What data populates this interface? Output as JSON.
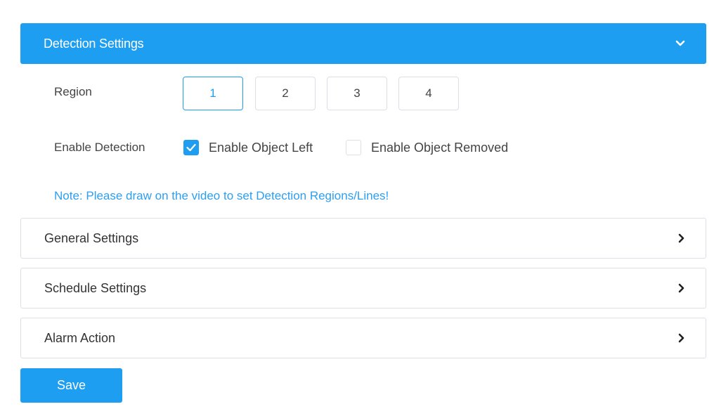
{
  "detection_panel": {
    "title": "Detection Settings",
    "expanded": true,
    "toggle_icon": "chevron-down-icon"
  },
  "region": {
    "label": "Region",
    "options": [
      "1",
      "2",
      "3",
      "4"
    ],
    "selected": "1"
  },
  "enable_detection": {
    "label": "Enable Detection",
    "options": [
      {
        "label": "Enable Object Left",
        "checked": true
      },
      {
        "label": "Enable Object Removed",
        "checked": false
      }
    ]
  },
  "note": "Note: Please draw on the video to set Detection Regions/Lines!",
  "collapsed_panels": [
    {
      "title": "General Settings",
      "icon": "chevron-right-icon"
    },
    {
      "title": "Schedule Settings",
      "icon": "chevron-right-icon"
    },
    {
      "title": "Alarm Action",
      "icon": "chevron-right-icon"
    }
  ],
  "save_button": {
    "label": "Save"
  },
  "colors": {
    "accent": "#1e9ef0",
    "note_text": "#2d9ff0",
    "border": "#dcdfe6",
    "text": "#333333"
  }
}
